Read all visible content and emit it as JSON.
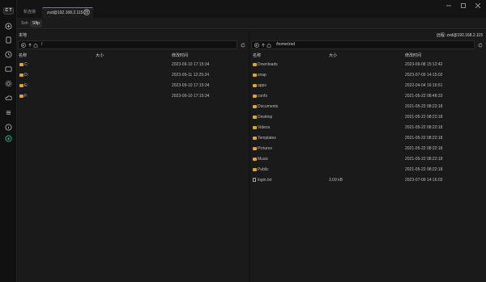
{
  "titlebar": {
    "tabs": [
      {
        "label": "新连接",
        "active": false
      },
      {
        "label": "zxd@192.168.2.115:22",
        "active": true
      }
    ],
    "add_tab": "+"
  },
  "subtabs": [
    {
      "label": "Ssh",
      "active": false
    },
    {
      "label": "Sftp",
      "active": true
    }
  ],
  "local": {
    "title": "本地",
    "path": "/",
    "columns": {
      "name": "名称",
      "size": "大小",
      "modified": "修改时间"
    },
    "rows": [
      {
        "name": "C:",
        "size": "",
        "modified": "2023-09-10 17:15:34"
      },
      {
        "name": "D:",
        "size": "",
        "modified": "2023-09-11 12:25:24"
      },
      {
        "name": "E:",
        "size": "",
        "modified": "2023-09-10 17:15:34"
      },
      {
        "name": "F:",
        "size": "",
        "modified": "2023-09-10 17:15:34"
      }
    ]
  },
  "remote": {
    "title": "远程: zxd@192.168.2.115",
    "path": "/home/zxd",
    "columns": {
      "name": "名称",
      "size": "大小",
      "modified": "修改时间"
    },
    "rows": [
      {
        "name": "Downloads",
        "type": "folder",
        "size": "",
        "modified": "2023-09-08 15:12:42"
      },
      {
        "name": "snap",
        "type": "folder",
        "size": "",
        "modified": "2023-07-09 14:15:02"
      },
      {
        "name": "apps",
        "type": "folder",
        "size": "",
        "modified": "2022-04-04 16:16:51"
      },
      {
        "name": "confs",
        "type": "folder",
        "size": "",
        "modified": "2021-05-22 08:48:33"
      },
      {
        "name": "Documents",
        "type": "folder",
        "size": "",
        "modified": "2021-05-22 08:22:18"
      },
      {
        "name": "Desktop",
        "type": "folder",
        "size": "",
        "modified": "2021-05-22 08:22:18"
      },
      {
        "name": "Videos",
        "type": "folder",
        "size": "",
        "modified": "2021-05-22 08:22:18"
      },
      {
        "name": "Templates",
        "type": "folder",
        "size": "",
        "modified": "2021-05-22 08:22:18"
      },
      {
        "name": "Pictures",
        "type": "folder",
        "size": "",
        "modified": "2021-05-22 08:22:18"
      },
      {
        "name": "Music",
        "type": "folder",
        "size": "",
        "modified": "2021-05-22 08:22:18"
      },
      {
        "name": "Public",
        "type": "folder",
        "size": "",
        "modified": "2021-05-22 08:22:18"
      },
      {
        "name": "login.txt",
        "type": "file",
        "size": "3.09 kB",
        "modified": "2023-07-09 14:16:03"
      }
    ]
  },
  "colors": {
    "accent": "#2a9d8f",
    "folder": "#d9a441",
    "background": "#151515"
  }
}
